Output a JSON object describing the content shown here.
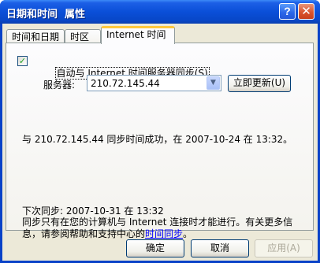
{
  "window": {
    "title": "日期和时间  属性",
    "help_glyph": "?",
    "close_glyph": "✕"
  },
  "tabs": [
    {
      "label": "时间和日期"
    },
    {
      "label": "时区"
    },
    {
      "label": "Internet 时间"
    }
  ],
  "internet_time": {
    "auto_sync_checked": true,
    "auto_sync_label": "自动与 Internet 时间服务器同步",
    "auto_sync_hotkey": "(S)",
    "server_label": "服务器:",
    "server_value": "210.72.145.44",
    "update_now_label": "立即更新",
    "update_now_hotkey": "(U)",
    "status_message": "与 210.72.145.44 同步时间成功，在 2007-10-24 在 13:32。",
    "next_sync": "下次同步: 2007-10-31 在 13:32",
    "info_line1": "同步只有在您的计算机与 Internet 连接时才能进行。有关更多信",
    "info_line2_prefix": "息，请参阅帮助和支持中心的",
    "info_link": "时间同步",
    "info_line2_suffix": "。"
  },
  "footer": {
    "ok_label": "确定",
    "cancel_label": "取消",
    "apply_label": "应用",
    "apply_hotkey": "(A)"
  },
  "colors": {
    "title_bar": "#0a4fd8",
    "dialog_face": "#ece9d8",
    "active_tab_accent": "#ffc83c",
    "checkmark": "#21a121",
    "link": "#0000ff"
  }
}
